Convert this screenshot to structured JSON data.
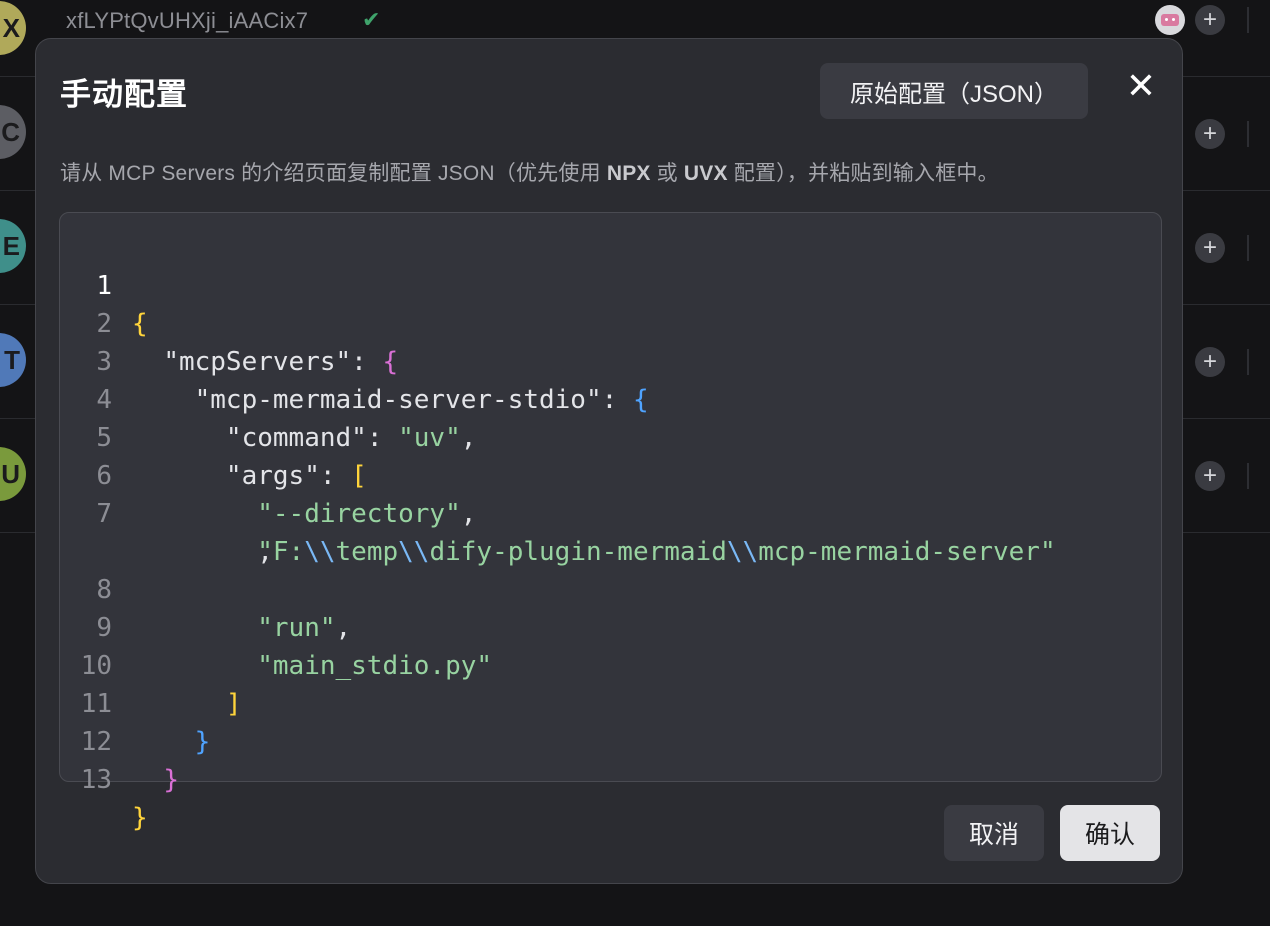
{
  "background": {
    "first_row_title": "xfLYPtQvUHXji_iAACix7",
    "rows": [
      {
        "avatar_letter": "X",
        "avatar_color": "#b0a95a"
      },
      {
        "avatar_letter": "C",
        "avatar_color": "#5c5d63"
      },
      {
        "avatar_letter": "E",
        "avatar_color": "#3f8f8a"
      },
      {
        "avatar_letter": "T",
        "avatar_color": "#5079b8"
      },
      {
        "avatar_letter": "U",
        "avatar_color": "#7a9a3c"
      }
    ],
    "add_icon": "+"
  },
  "modal": {
    "title": "手动配置",
    "raw_json_button": "原始配置（JSON）",
    "close_icon": "✕",
    "description": {
      "part1": "请从 MCP Servers 的介绍页面复制配置 JSON（优先使用 ",
      "npx": "NPX",
      "part2": " 或 ",
      "uvx": "UVX",
      "part3": " 配置），并粘贴到输入框中。"
    },
    "cancel": "取消",
    "confirm": "确认"
  },
  "editor": {
    "line_numbers": [
      "1",
      "2",
      "3",
      "4",
      "5",
      "6",
      "7",
      "8",
      "9",
      "10",
      "11",
      "12",
      "13"
    ],
    "server_key": "\"mcp-mermaid-server-stdio\"",
    "servers_key": "\"mcpServers\"",
    "command_key": "\"command\"",
    "command_value": "\"uv\"",
    "args_key": "\"args\"",
    "arg1": "\"--directory\"",
    "arg2_parts": [
      "\"F:",
      "\\\\",
      "temp",
      "\\\\",
      "dify-plugin-mermaid",
      "\\\\",
      "mcp-mermaid-server\""
    ],
    "arg3": "\"run\"",
    "arg4": "\"main_stdio.py\""
  },
  "colors": {
    "string": "#98d3a1",
    "escape": "#7ab8f5",
    "bracket_level1": "#ffd43b",
    "bracket_level2": "#da70d6",
    "bracket_level3": "#4fa3ff"
  }
}
